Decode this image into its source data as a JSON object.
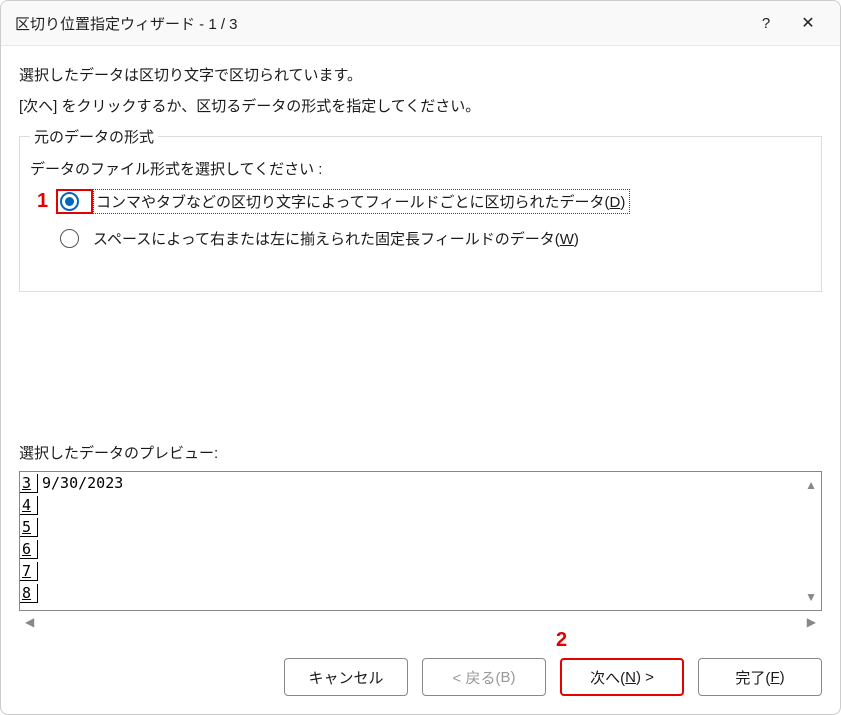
{
  "titlebar": {
    "title": "区切り位置指定ウィザード - 1 / 3",
    "help": "?",
    "close": "✕"
  },
  "description": {
    "line1": "選択したデータは区切り文字で区切られています。",
    "line2": "[次へ] をクリックするか、区切るデータの形式を指定してください。"
  },
  "group": {
    "title": "元のデータの形式",
    "instruction": "データのファイル形式を選択してください :",
    "radio1": {
      "label_prefix": "コンマやタブなどの区切り文字によってフィールドごとに区切られたデータ(",
      "accel": "D",
      "label_suffix": ")"
    },
    "radio2": {
      "label_prefix": "スペースによって右または左に揃えられた固定長フィールドのデータ(",
      "accel": "W",
      "label_suffix": ")"
    }
  },
  "preview": {
    "label": "選択したデータのプレビュー:",
    "rows": [
      {
        "num": "3",
        "data": "9/30/2023"
      },
      {
        "num": "4",
        "data": ""
      },
      {
        "num": "5",
        "data": ""
      },
      {
        "num": "6",
        "data": ""
      },
      {
        "num": "7",
        "data": ""
      },
      {
        "num": "8",
        "data": ""
      }
    ]
  },
  "buttons": {
    "cancel": "キャンセル",
    "back_prefix": "< 戻る(",
    "back_accel": "B",
    "back_suffix": ")",
    "next_prefix": "次へ(",
    "next_accel": "N",
    "next_suffix": ") >",
    "finish_prefix": "完了(",
    "finish_accel": "F",
    "finish_suffix": ")"
  },
  "annotations": {
    "one": "1",
    "two": "2"
  }
}
